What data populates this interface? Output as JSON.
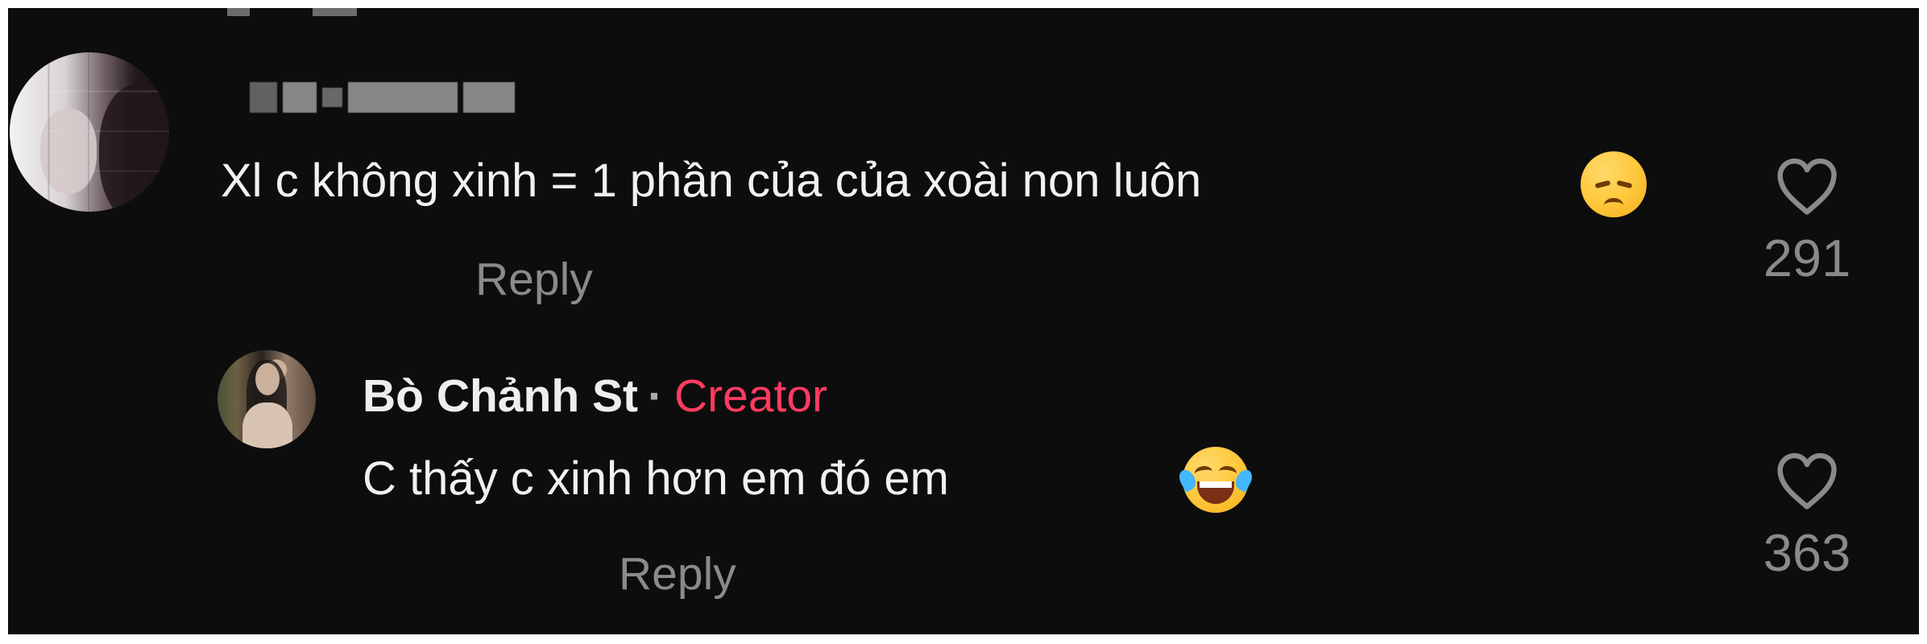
{
  "comments": [
    {
      "author_name": "",
      "text": "Xl c không xinh = 1 phần của của xoài non luôn",
      "emoji": "disappointed-face-emoji",
      "date": "",
      "reply_label": "Reply",
      "likes": "291"
    }
  ],
  "reply": {
    "author_name": "Bò Chảnh St",
    "separator": "·",
    "badge": "Creator",
    "text": "C thấy c xinh hơn em đó em",
    "emoji": "tears-of-joy-emoji",
    "date": "",
    "reply_label": "Reply",
    "likes": "363"
  },
  "colors": {
    "background": "#0d0d0e",
    "text": "#f1f1f1",
    "muted": "#8a8a8a",
    "creator": "#ff3b60"
  },
  "icons": {
    "like": "heart-outline-icon"
  }
}
